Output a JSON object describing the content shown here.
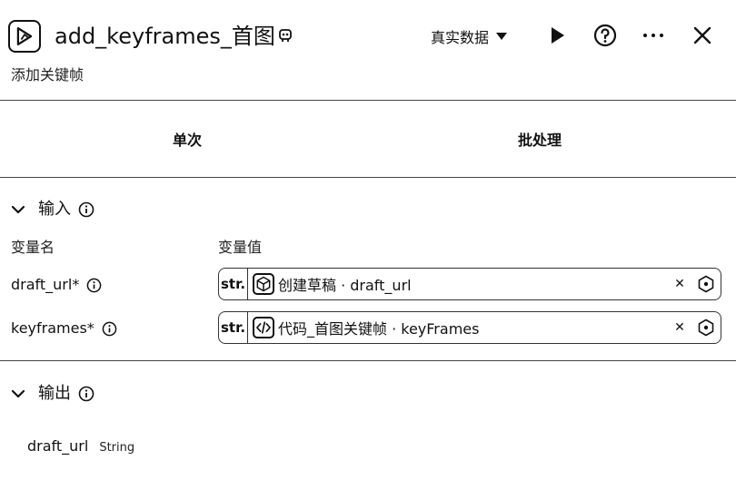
{
  "header": {
    "title": "add_keyframes_首图",
    "subtitle": "添加关键帧",
    "data_mode": "真实数据",
    "icons": [
      "app-icon",
      "robot-badge-icon",
      "play-icon",
      "help-icon",
      "more-icon",
      "close-icon"
    ]
  },
  "tabs": [
    {
      "label": "单次"
    },
    {
      "label": "批处理"
    }
  ],
  "input_section": {
    "title": "输入",
    "col_name": "变量名",
    "col_value": "变量值",
    "params": [
      {
        "name": "draft_url*",
        "type": "str.",
        "ref": "创建草稿 · draft_url",
        "ref_icon": "cube-icon"
      },
      {
        "name": "keyframes*",
        "type": "str.",
        "ref": "代码_首图关键帧 · keyFrames",
        "ref_icon": "code-icon"
      }
    ]
  },
  "output_section": {
    "title": "输出",
    "outputs": [
      {
        "name": "draft_url",
        "type": "String"
      }
    ]
  }
}
